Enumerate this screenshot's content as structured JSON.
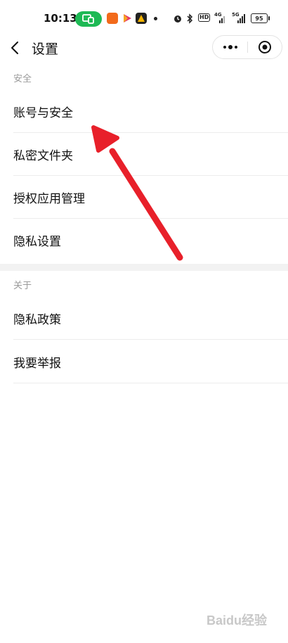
{
  "status_bar": {
    "time": "10:13",
    "hd": "HD",
    "net1": "4G",
    "net2": "5G",
    "battery": "95"
  },
  "nav": {
    "title": "设置"
  },
  "sections": [
    {
      "header": "安全",
      "items": [
        "账号与安全",
        "私密文件夹",
        "授权应用管理",
        "隐私设置"
      ]
    },
    {
      "header": "关于",
      "items": [
        "隐私政策",
        "我要举报"
      ]
    }
  ],
  "colors": {
    "arrow": "#e8202a",
    "cast_pill": "#1db954"
  },
  "watermark": {
    "text": "Baidu经验"
  }
}
